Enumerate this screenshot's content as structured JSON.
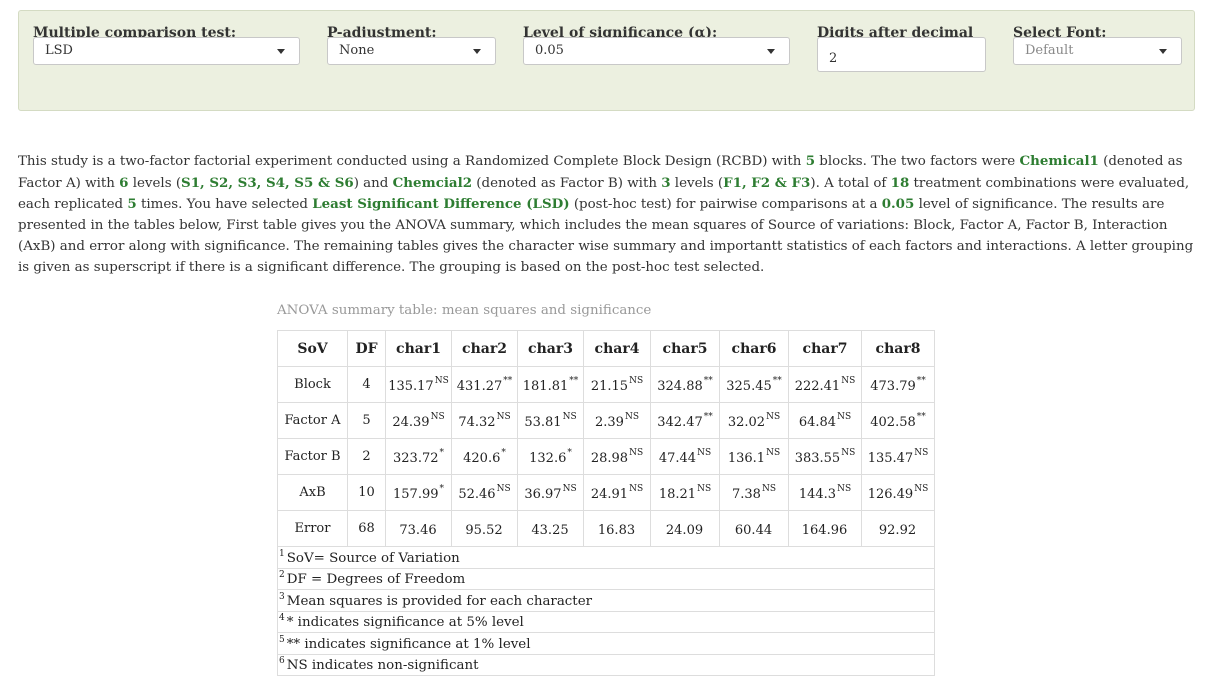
{
  "controls": {
    "test": {
      "label": "Multiple comparison test:",
      "value": "LSD"
    },
    "padj": {
      "label": "P-adjustment:",
      "value": "None"
    },
    "alpha": {
      "label": "Level of significance (α):",
      "value": "0.05"
    },
    "digits": {
      "label": "Digits after decimal",
      "value": "2"
    },
    "font": {
      "label": "Select Font:",
      "placeholder": "Default"
    }
  },
  "description": {
    "p1": "This study is a two-factor factorial experiment conducted using a Randomized Complete Block Design (RCBD) with ",
    "blocks": "5",
    "p2": " blocks. The two factors were ",
    "factor_a": "Chemical1",
    "p3": " (denoted as Factor A) with ",
    "a_levels": "6",
    "p4": " levels (",
    "a_names": "S1, S2, S3, S4, S5 & S6",
    "p5": ") and ",
    "factor_b": "Chemcial2",
    "p6": " (denoted as Factor B) with ",
    "b_levels": "3",
    "p7": " levels (",
    "b_names": "F1, F2 & F3",
    "p8": "). A total of ",
    "combos": "18",
    "p9": " treatment combinations were evaluated, each replicated ",
    "reps": "5",
    "p10": " times. You have selected ",
    "test_name": "Least Significant Difference (LSD)",
    "p11": " (post-hoc test) for pairwise comparisons at a ",
    "alpha": "0.05",
    "p12": " level of significance. The results are presented in the tables below, First table gives you the ANOVA summary, which includes the mean squares of Source of variations: Block, Factor A, Factor B, Interaction (AxB) and error along with significance. The remaining tables gives the character wise summary and importantt statistics of each factors and interactions. A letter grouping is given as superscript if there is a significant difference. The grouping is based on the post-hoc test selected."
  },
  "table": {
    "caption": "ANOVA summary table: mean squares and significance",
    "headers": [
      "SoV",
      "DF",
      "char1",
      "char2",
      "char3",
      "char4",
      "char5",
      "char6",
      "char7",
      "char8"
    ],
    "rows": [
      {
        "sov": "Block",
        "df": "4",
        "cells": [
          [
            "135.17",
            "NS"
          ],
          [
            "431.27",
            "**"
          ],
          [
            "181.81",
            "**"
          ],
          [
            "21.15",
            "NS"
          ],
          [
            "324.88",
            "**"
          ],
          [
            "325.45",
            "**"
          ],
          [
            "222.41",
            "NS"
          ],
          [
            "473.79",
            "**"
          ]
        ]
      },
      {
        "sov": "Factor A",
        "df": "5",
        "cells": [
          [
            "24.39",
            "NS"
          ],
          [
            "74.32",
            "NS"
          ],
          [
            "53.81",
            "NS"
          ],
          [
            "2.39",
            "NS"
          ],
          [
            "342.47",
            "**"
          ],
          [
            "32.02",
            "NS"
          ],
          [
            "64.84",
            "NS"
          ],
          [
            "402.58",
            "**"
          ]
        ]
      },
      {
        "sov": "Factor B",
        "df": "2",
        "cells": [
          [
            "323.72",
            "*"
          ],
          [
            "420.6",
            "*"
          ],
          [
            "132.6",
            "*"
          ],
          [
            "28.98",
            "NS"
          ],
          [
            "47.44",
            "NS"
          ],
          [
            "136.1",
            "NS"
          ],
          [
            "383.55",
            "NS"
          ],
          [
            "135.47",
            "NS"
          ]
        ]
      },
      {
        "sov": "AxB",
        "df": "10",
        "cells": [
          [
            "157.99",
            "*"
          ],
          [
            "52.46",
            "NS"
          ],
          [
            "36.97",
            "NS"
          ],
          [
            "24.91",
            "NS"
          ],
          [
            "18.21",
            "NS"
          ],
          [
            "7.38",
            "NS"
          ],
          [
            "144.3",
            "NS"
          ],
          [
            "126.49",
            "NS"
          ]
        ]
      },
      {
        "sov": "Error",
        "df": "68",
        "cells": [
          [
            "73.46",
            ""
          ],
          [
            "95.52",
            ""
          ],
          [
            "43.25",
            ""
          ],
          [
            "16.83",
            ""
          ],
          [
            "24.09",
            ""
          ],
          [
            "60.44",
            ""
          ],
          [
            "164.96",
            ""
          ],
          [
            "92.92",
            ""
          ]
        ]
      }
    ],
    "footnotes": [
      {
        "num": "1",
        "text": "SoV= Source of Variation"
      },
      {
        "num": "2",
        "text": "DF = Degrees of Freedom"
      },
      {
        "num": "3",
        "text": "Mean squares is provided for each character"
      },
      {
        "num": "4",
        "text": "* indicates significance at 5% level"
      },
      {
        "num": "5",
        "text": "** indicates significance at 1% level"
      },
      {
        "num": "6",
        "text": "NS indicates non-significant"
      }
    ]
  }
}
